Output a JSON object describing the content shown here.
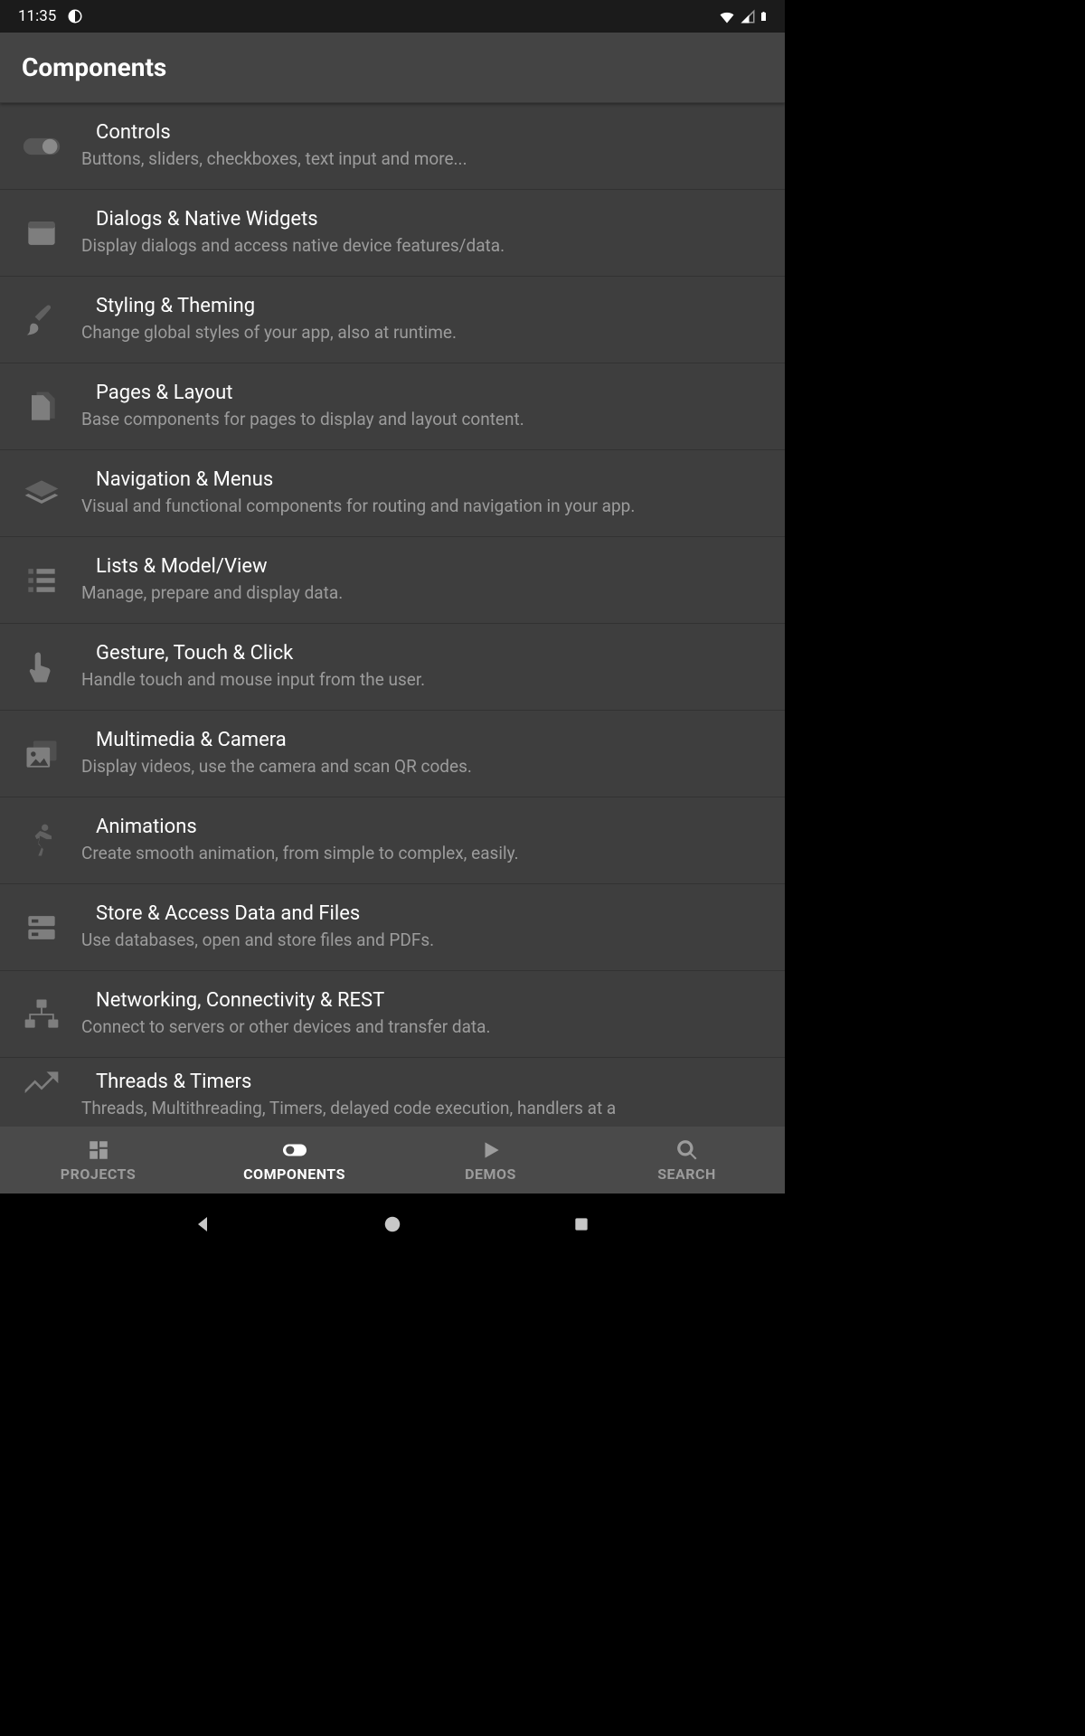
{
  "status": {
    "time": "11:35"
  },
  "header": {
    "title": "Components"
  },
  "items": [
    {
      "title": "Controls",
      "sub": "Buttons, sliders, checkboxes, text input and more..."
    },
    {
      "title": "Dialogs & Native Widgets",
      "sub": "Display dialogs and access native device features/data."
    },
    {
      "title": "Styling & Theming",
      "sub": "Change global styles of your app, also at runtime."
    },
    {
      "title": "Pages & Layout",
      "sub": "Base components for pages to display and layout content."
    },
    {
      "title": "Navigation & Menus",
      "sub": "Visual and functional components for routing and navigation in your app."
    },
    {
      "title": "Lists & Model/View",
      "sub": "Manage, prepare and display data."
    },
    {
      "title": "Gesture, Touch & Click",
      "sub": "Handle touch and mouse input from the user."
    },
    {
      "title": "Multimedia & Camera",
      "sub": "Display videos, use the camera and scan QR codes."
    },
    {
      "title": "Animations",
      "sub": "Create smooth animation, from simple to complex, easily."
    },
    {
      "title": "Store & Access Data and Files",
      "sub": "Use databases, open and store files and PDFs."
    },
    {
      "title": "Networking, Connectivity & REST",
      "sub": "Connect to servers or other devices and transfer data."
    },
    {
      "title": "Threads & Timers",
      "sub": "Threads, Multithreading, Timers, delayed code execution, handlers at a"
    }
  ],
  "tabs": {
    "projects": {
      "label": "PROJECTS"
    },
    "components": {
      "label": "COMPONENTS"
    },
    "demos": {
      "label": "DEMOS"
    },
    "search": {
      "label": "SEARCH"
    }
  }
}
